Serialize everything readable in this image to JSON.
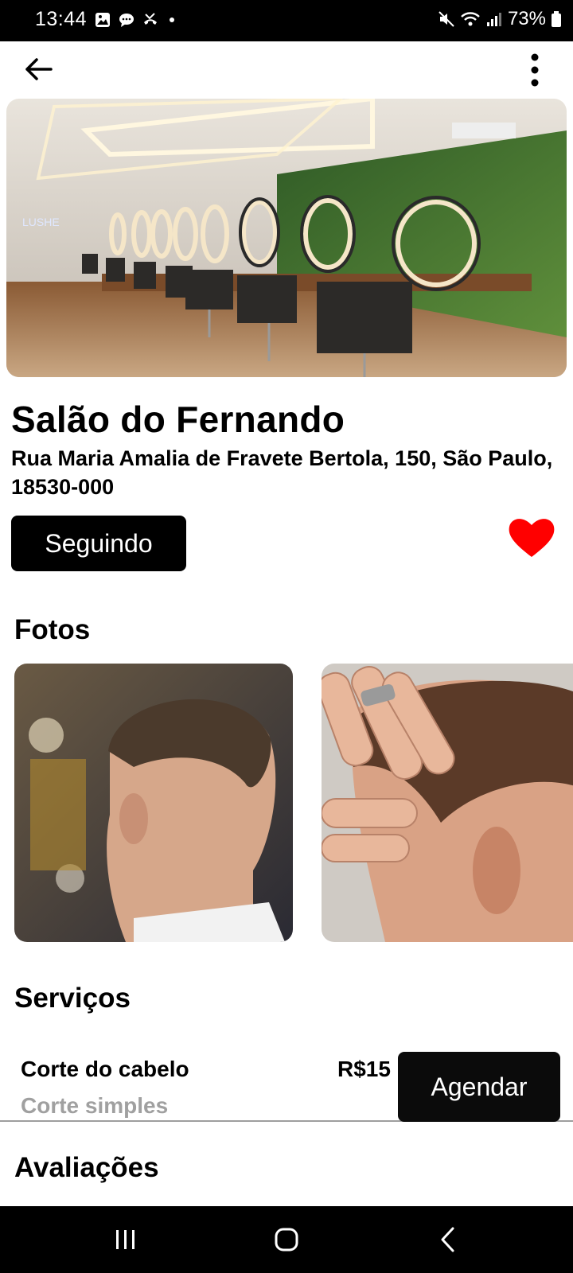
{
  "status_bar": {
    "time": "13:44",
    "battery": "73%"
  },
  "app_bar": {
    "back_icon": "arrow-left-icon",
    "menu_icon": "more-vertical-icon"
  },
  "salon": {
    "name": "Salão do Fernando",
    "address": "Rua Maria Amalia de Fravete Bertola, 150, São Paulo, 18530-000",
    "follow_label": "Seguindo",
    "favorite": true,
    "favorite_color": "#ff0000",
    "hero_sign_text": "LUSHE"
  },
  "sections": {
    "photos": "Fotos",
    "services": "Serviços",
    "reviews": "Avaliações"
  },
  "services": [
    {
      "name": "Corte do cabelo",
      "description": "Corte simples",
      "price": "R$15",
      "action_label": "Agendar"
    }
  ],
  "nav": {
    "recents_icon": "recent-apps-icon",
    "home_icon": "home-icon",
    "back_icon": "back-chevron-icon"
  }
}
